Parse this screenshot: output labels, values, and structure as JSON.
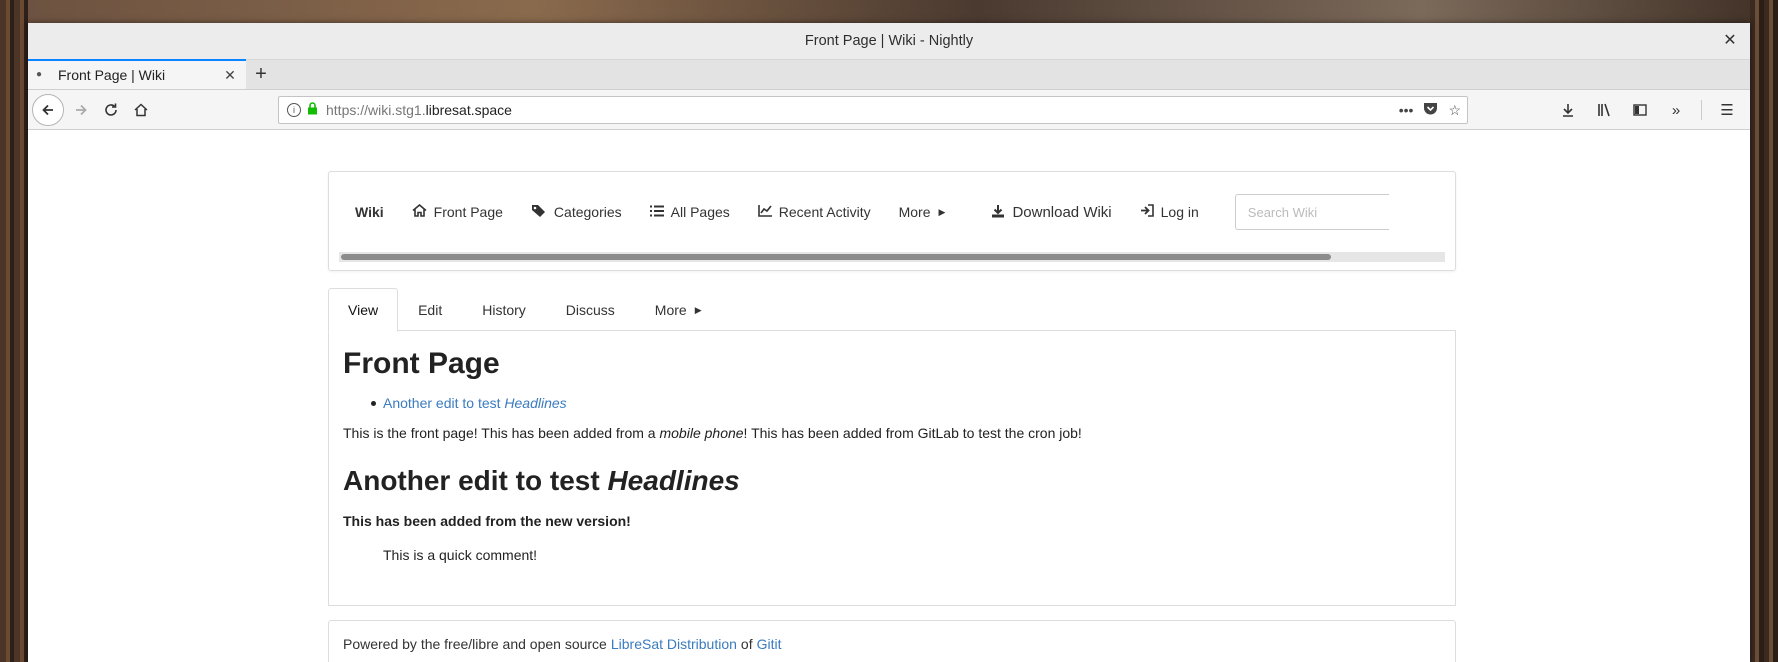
{
  "window": {
    "title": "Front Page | Wiki - Nightly",
    "close": "✕"
  },
  "browser": {
    "tab": {
      "title": "Front Page | Wiki",
      "close": "✕"
    },
    "newtab": "+",
    "url": {
      "dim": "https://wiki.stg1.",
      "host": "libresat.space"
    }
  },
  "wiki_nav": {
    "brand": "Wiki",
    "items": [
      {
        "label": "Front Page",
        "icon": "home-icon"
      },
      {
        "label": "Categories",
        "icon": "tags-icon"
      },
      {
        "label": "All Pages",
        "icon": "list-icon"
      },
      {
        "label": "Recent Activity",
        "icon": "chart-icon"
      },
      {
        "label": "More",
        "icon": "caret-right-icon"
      }
    ],
    "download": "Download Wiki",
    "login": "Log in",
    "search_placeholder": "Search Wiki"
  },
  "page_tabs": [
    "View",
    "Edit",
    "History",
    "Discuss",
    "More"
  ],
  "article": {
    "title": "Front Page",
    "toc_link_prefix": "Another edit to test ",
    "toc_link_em": "Headlines",
    "para_pre": "This is the front page! This has been added from a ",
    "para_em": "mobile phone",
    "para_post": "! This has been added from GitLab to test the cron job!",
    "h2_pre": "Another edit to test ",
    "h2_em": "Headlines",
    "bold_line": "This has been added from the new version!",
    "comment": "This is a quick comment!"
  },
  "footer": {
    "pre": "Powered by the free/libre and open source",
    "link1": "LibreSat Distribution",
    "mid": "of",
    "link2": "Gitit"
  }
}
